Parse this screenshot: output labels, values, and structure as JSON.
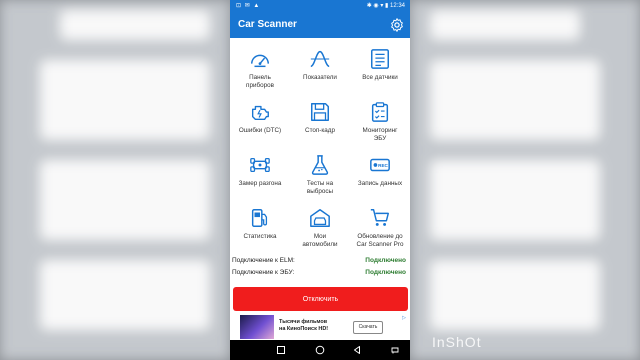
{
  "status_bar": {
    "left_icons": "⊡ ✉ ▲",
    "right_icons": "✱ ◉ ▾ ▮ 12:34"
  },
  "app_bar": {
    "title": "Car Scanner",
    "settings_icon": "gear-icon"
  },
  "accent_color": "#1976d2",
  "tiles": [
    {
      "label": "Панель\nприборов",
      "icon": "speedometer-icon"
    },
    {
      "label": "Показатели",
      "icon": "waveform-icon"
    },
    {
      "label": "Все датчики",
      "icon": "list-icon"
    },
    {
      "label": "Ошибки (DTC)",
      "icon": "engine-icon"
    },
    {
      "label": "Стоп-кадр",
      "icon": "floppy-disk-icon"
    },
    {
      "label": "Мониторинг\nЭБУ",
      "icon": "clipboard-check-icon"
    },
    {
      "label": "Замер разгона",
      "icon": "race-car-icon"
    },
    {
      "label": "Тесты на\nвыбросы",
      "icon": "flask-icon"
    },
    {
      "label": "Запись данных",
      "icon": "rec-icon"
    },
    {
      "label": "Статистика",
      "icon": "fuel-pump-icon"
    },
    {
      "label": "Мои\nавтомобили",
      "icon": "garage-icon"
    },
    {
      "label": "Обновление до\nCar Scanner Pro",
      "icon": "cart-icon"
    }
  ],
  "connection": {
    "elm_label": "Подключение к ELM:",
    "elm_status": "Подключено",
    "ecu_label": "Подключение к ЭБУ:",
    "ecu_status": "Подключено",
    "status_color": "#2e7d32"
  },
  "disconnect_button": {
    "label": "Отключить",
    "color": "#f01d1d"
  },
  "ad": {
    "text": "Тысячи фильмов\nна КиноПоиск HD!",
    "button": "Скачать",
    "mark": "▷"
  },
  "nav_bar": {
    "buttons": [
      "recents-icon",
      "home-icon",
      "back-icon",
      "notification-icon"
    ]
  },
  "watermark": "InShOt"
}
